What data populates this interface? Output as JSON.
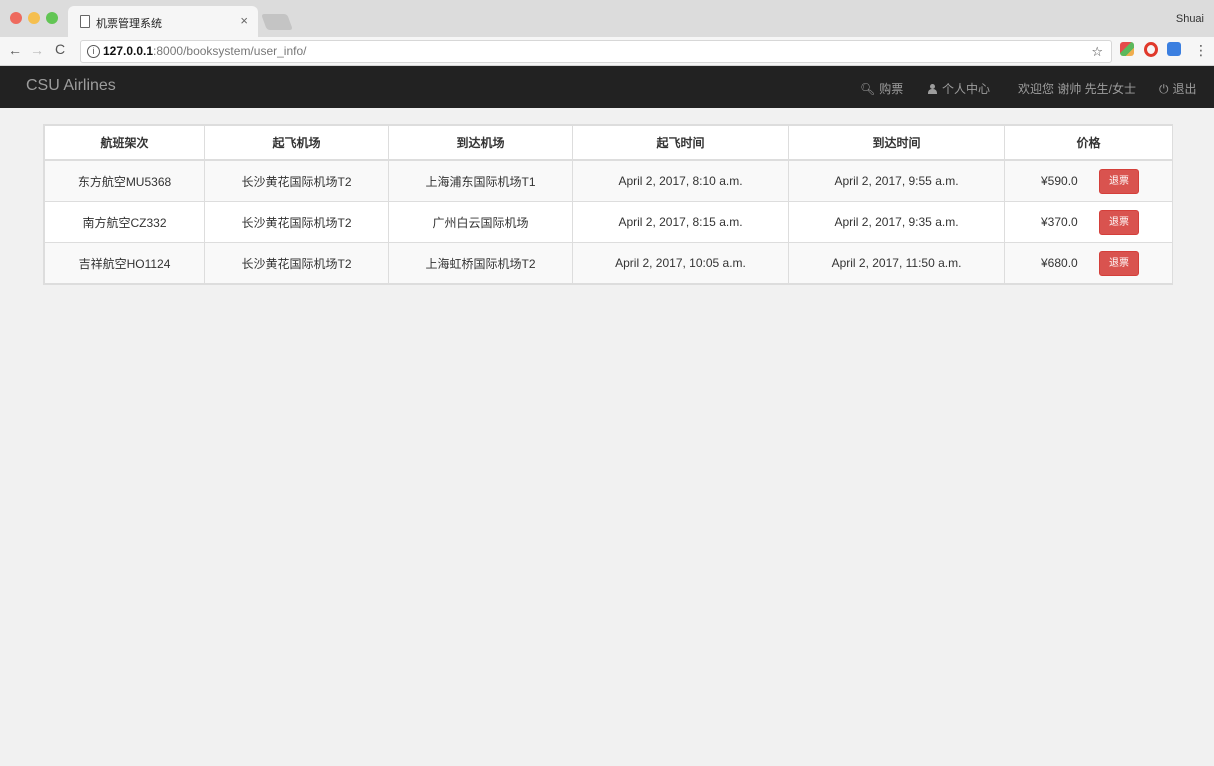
{
  "browser": {
    "tab_title": "机票管理系统",
    "tab_close": "×",
    "profile_name": "Shuai",
    "url_host": "127.0.0.1",
    "url_rest": ":8000/booksystem/user_info/"
  },
  "navbar": {
    "brand": "CSU Airlines",
    "buy_label": "购票",
    "center_label": "个人中心",
    "welcome_text": "欢迎您 谢帅 先生/女士",
    "logout_label": "退出"
  },
  "table": {
    "headers": [
      "航班架次",
      "起飞机场",
      "到达机场",
      "起飞时间",
      "到达时间",
      "价格"
    ],
    "rows": [
      {
        "flight": "东方航空MU5368",
        "from": "长沙黄花国际机场T2",
        "to": "上海浦东国际机场T1",
        "depart": "April 2, 2017, 8:10 a.m.",
        "arrive": "April 2, 2017, 9:55 a.m.",
        "price": "¥590.0",
        "action": "退票"
      },
      {
        "flight": "南方航空CZ332",
        "from": "长沙黄花国际机场T2",
        "to": "广州白云国际机场",
        "depart": "April 2, 2017, 8:15 a.m.",
        "arrive": "April 2, 2017, 9:35 a.m.",
        "price": "¥370.0",
        "action": "退票"
      },
      {
        "flight": "吉祥航空HO1124",
        "from": "长沙黄花国际机场T2",
        "to": "上海虹桥国际机场T2",
        "depart": "April 2, 2017, 10:05 a.m.",
        "arrive": "April 2, 2017, 11:50 a.m.",
        "price": "¥680.0",
        "action": "退票"
      }
    ]
  },
  "icons": {
    "back": "arrow-left-icon",
    "forward": "arrow-right-icon",
    "reload": "reload-icon",
    "bookmark": "star-icon",
    "search": "search-icon",
    "user": "user-icon",
    "power": "power-icon"
  },
  "colors": {
    "navbar_bg": "#222222",
    "navbar_text": "#9d9d9d",
    "refund_button": "#d9534f",
    "page_bg": "#f1f1f1"
  }
}
